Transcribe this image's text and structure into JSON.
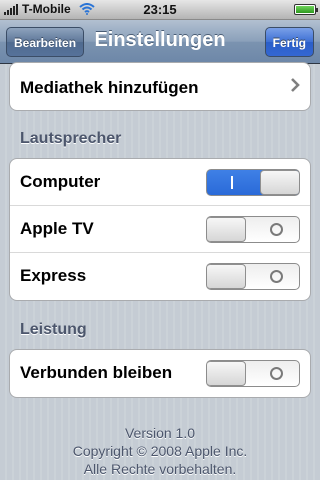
{
  "status_bar": {
    "carrier": "T-Mobile",
    "time": "23:15",
    "signal_icon": "signal-bars-icon",
    "wifi_icon": "wifi-icon",
    "battery_icon": "battery-icon",
    "battery_level": 1.0
  },
  "nav": {
    "title": "Einstellungen",
    "left_button": "Bearbeiten",
    "right_button": "Fertig"
  },
  "library_row": {
    "label": "Mediathek hinzufügen",
    "icon": "chevron-right-icon"
  },
  "speakers": {
    "header": "Lautsprecher",
    "items": [
      {
        "label": "Computer",
        "on": true
      },
      {
        "label": "Apple TV",
        "on": false
      },
      {
        "label": "Express",
        "on": false
      }
    ]
  },
  "performance": {
    "header": "Leistung",
    "items": [
      {
        "label": "Verbunden bleiben",
        "on": false
      }
    ]
  },
  "footer": {
    "version": "Version 1.0",
    "copyright": "Copyright © 2008 Apple Inc.",
    "rights": "Alle Rechte vorbehalten."
  },
  "colors": {
    "nav_bar": "#7b93b0",
    "done_button": "#2a5ec9",
    "toggle_on": "#2a6ad8",
    "section_text": "#4c566c"
  }
}
